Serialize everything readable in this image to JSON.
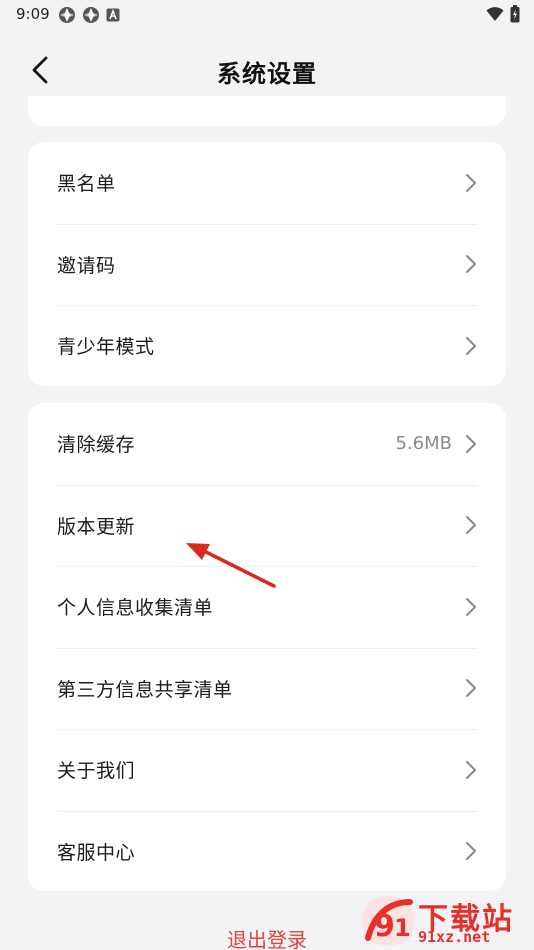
{
  "status_bar": {
    "time": "9:09",
    "left_icons": [
      "app-notification-icon",
      "app-notification-icon",
      "a-badge-icon"
    ],
    "right_icons": [
      "wifi-icon",
      "battery-icon"
    ]
  },
  "header": {
    "title": "系统设置",
    "back_icon": "chevron-left-icon"
  },
  "groups": [
    {
      "items": [
        {
          "label": "黑名单"
        },
        {
          "label": "邀请码"
        },
        {
          "label": "青少年模式"
        }
      ]
    },
    {
      "items": [
        {
          "label": "清除缓存",
          "value": "5.6MB"
        },
        {
          "label": "版本更新"
        },
        {
          "label": "个人信息收集清单"
        },
        {
          "label": "第三方信息共享清单"
        },
        {
          "label": "关于我们"
        },
        {
          "label": "客服中心"
        }
      ]
    }
  ],
  "logout_label": "退出登录",
  "watermark": {
    "text": "下载站",
    "sub": "91xz.net"
  },
  "colors": {
    "background": "#f3f3f6",
    "card": "#ffffff",
    "logout": "#e0433f",
    "annotation": "#d92a22",
    "watermark": "#e8302a"
  }
}
